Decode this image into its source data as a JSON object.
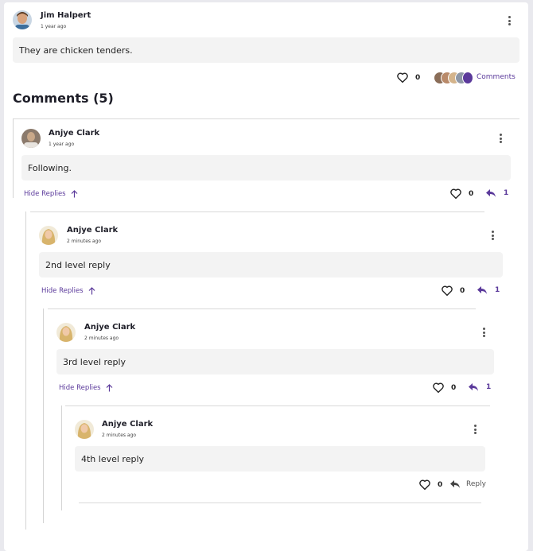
{
  "post": {
    "author": "Jim Halpert",
    "time": "1 year ago",
    "text": "They are chicken tenders.",
    "like_count": "0",
    "comments_label": "Comments"
  },
  "comments_header": {
    "label": "Comments (5)"
  },
  "comments": [
    {
      "author": "Anjye Clark",
      "time": "1 year ago",
      "text": "Following.",
      "like_count": "0",
      "reply_count": "1",
      "hide_label": "Hide Replies"
    },
    {
      "author": "Anjye Clark",
      "time": "2 minutes ago",
      "text": "2nd level reply",
      "like_count": "0",
      "reply_count": "1",
      "hide_label": "Hide Replies"
    },
    {
      "author": "Anjye Clark",
      "time": "2 minutes ago",
      "text": "3rd level reply",
      "like_count": "0",
      "reply_count": "1",
      "hide_label": "Hide Replies"
    },
    {
      "author": "Anjye Clark",
      "time": "2 minutes ago",
      "text": "4th level reply",
      "like_count": "0",
      "reply_label": "Reply"
    }
  ],
  "colors": {
    "accent": "#5b3a9b",
    "bubble": "#f3f3f3",
    "background": "#e9e9ee"
  },
  "icons": [
    "avatar",
    "kebab-menu-icon",
    "heart-icon",
    "reply-arrow-icon",
    "arrow-up-icon"
  ]
}
